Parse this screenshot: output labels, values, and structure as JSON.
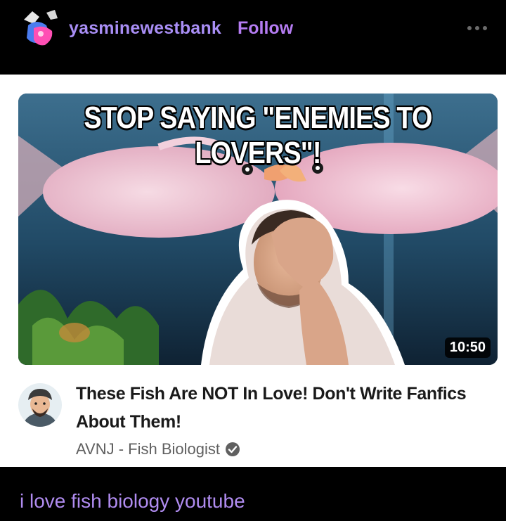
{
  "post": {
    "username": "yasminewestbank",
    "follow_label": "Follow",
    "more_icon": "ellipsis-icon",
    "caption": "i love fish biology youtube"
  },
  "video": {
    "thumbnail_title": "STOP SAYING \"ENEMIES TO LOVERS\"!",
    "duration": "10:50",
    "title": "These Fish Are NOT In Love! Don't Write Fanfics About Them!",
    "channel": "AVNJ - Fish Biologist",
    "verified_icon": "verified-check-icon"
  },
  "colors": {
    "background": "#000000",
    "username": "#a98ef5",
    "follow": "#b57cf2",
    "caption": "#b08cf0",
    "card": "#ffffff"
  }
}
